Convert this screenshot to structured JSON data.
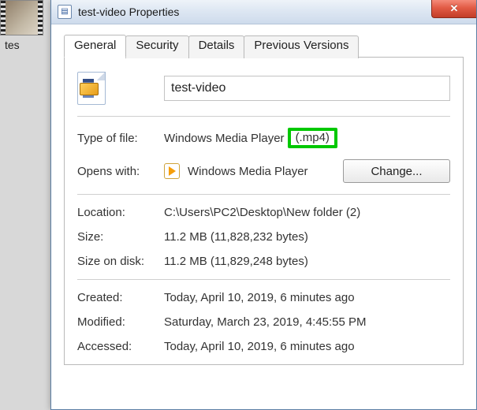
{
  "background": {
    "thumb_label": "tes"
  },
  "window": {
    "title": "test-video Properties",
    "tabs": [
      {
        "label": "General",
        "active": true
      },
      {
        "label": "Security",
        "active": false
      },
      {
        "label": "Details",
        "active": false
      },
      {
        "label": "Previous Versions",
        "active": false
      }
    ],
    "filename": "test-video",
    "type_of_file_label": "Type of file:",
    "type_of_file_value": "Windows Media Player",
    "type_of_file_ext": "(.mp4)",
    "opens_with_label": "Opens with:",
    "opens_with_app": "Windows Media Player",
    "change_button": "Change...",
    "location_label": "Location:",
    "location_value": "C:\\Users\\PC2\\Desktop\\New folder (2)",
    "size_label": "Size:",
    "size_value": "11.2 MB (11,828,232 bytes)",
    "size_on_disk_label": "Size on disk:",
    "size_on_disk_value": "11.2 MB (11,829,248 bytes)",
    "created_label": "Created:",
    "created_value": "Today, April 10, 2019, 6 minutes ago",
    "modified_label": "Modified:",
    "modified_value": "Saturday, March 23, 2019, 4:45:55 PM",
    "accessed_label": "Accessed:",
    "accessed_value": "Today, April 10, 2019, 6 minutes ago"
  }
}
